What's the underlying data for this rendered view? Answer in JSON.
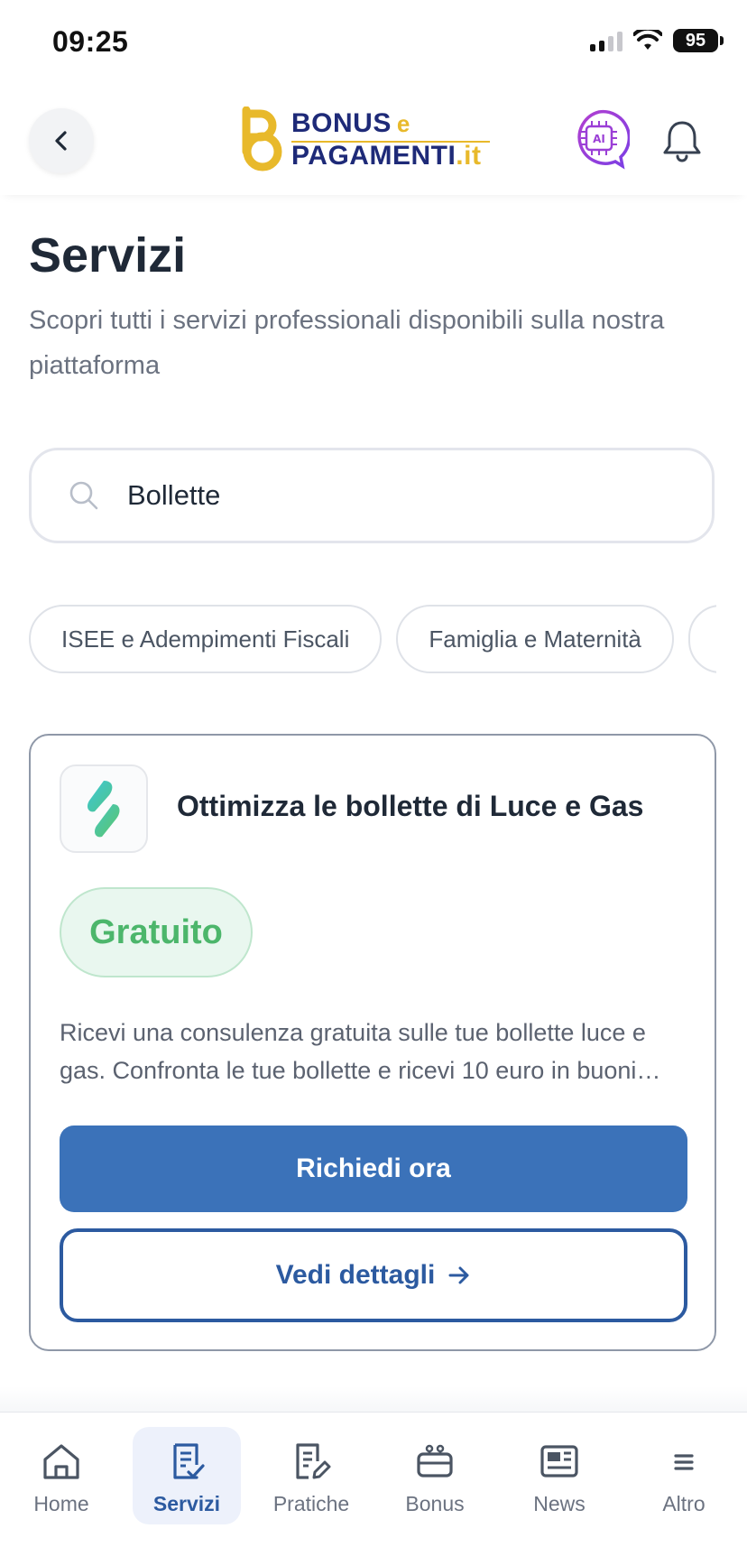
{
  "status_bar": {
    "time": "09:25",
    "battery": "95"
  },
  "header": {
    "logo": {
      "line1": "BONUS",
      "line1_e": "e",
      "line2": "PAGAMENTI",
      "line2_suffix": ".it"
    },
    "ai_badge": "AI"
  },
  "page": {
    "title": "Servizi",
    "subtitle": "Scopri tutti i servizi professionali disponibili sulla nostra piattaforma"
  },
  "search": {
    "value": "Bollette"
  },
  "filters": [
    {
      "label": "ISEE e Adempimenti Fiscali"
    },
    {
      "label": "Famiglia e Maternità"
    },
    {
      "label": ""
    }
  ],
  "service_card": {
    "title": "Ottimizza le bollette di Luce e Gas",
    "price_badge": "Gratuito",
    "description": "Ricevi una consulenza gratuita sulle tue bollette luce e gas. Confronta le tue bollette e ricevi 10 euro in buoni…",
    "primary_cta": "Richiedi ora",
    "secondary_cta": "Vedi dettagli"
  },
  "bottom_nav": {
    "items": [
      {
        "label": "Home",
        "icon": "home-icon"
      },
      {
        "label": "Servizi",
        "icon": "services-icon",
        "active": true
      },
      {
        "label": "Pratiche",
        "icon": "edit-document-icon"
      },
      {
        "label": "Bonus",
        "icon": "bonus-icon"
      },
      {
        "label": "News",
        "icon": "news-icon"
      },
      {
        "label": "Altro",
        "icon": "menu-icon"
      }
    ]
  },
  "colors": {
    "primary": "#3b72b9",
    "secondary_border": "#2c5aa0",
    "badge_green": "#4cb66b",
    "logo_navy": "#1e2a78",
    "logo_gold": "#e8b92b",
    "ai_purple": "#9b3fd6"
  }
}
